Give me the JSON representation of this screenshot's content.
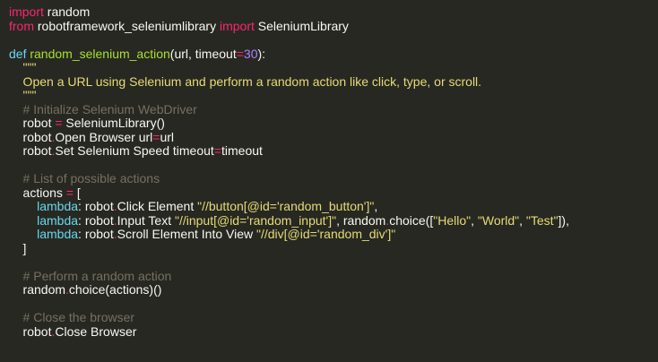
{
  "colors": {
    "background": "#272822",
    "plain": "#f8f8f2",
    "keyword": "#f92672",
    "function": "#a6e22e",
    "number": "#ae81ff",
    "string": "#e6db74",
    "comment": "#75715e",
    "builtin": "#66d9ef"
  },
  "code": {
    "lines": [
      [
        {
          "t": "kw",
          "v": "import"
        },
        {
          "t": "plain",
          "v": " random"
        }
      ],
      [
        {
          "t": "kw",
          "v": "from"
        },
        {
          "t": "plain",
          "v": " robotframework_seleniumlibrary "
        },
        {
          "t": "kw",
          "v": "import"
        },
        {
          "t": "plain",
          "v": " SeleniumLibrary"
        }
      ],
      [],
      [
        {
          "t": "builtin",
          "v": "def"
        },
        {
          "t": "plain",
          "v": " "
        },
        {
          "t": "fn",
          "v": "random_selenium_action"
        },
        {
          "t": "plain",
          "v": "(url, timeout"
        },
        {
          "t": "kw",
          "v": "="
        },
        {
          "t": "num",
          "v": "30"
        },
        {
          "t": "plain",
          "v": "):"
        }
      ],
      [
        {
          "t": "str",
          "v": "    \"\"\""
        }
      ],
      [
        {
          "t": "str",
          "v": "    Open a URL using Selenium and perform a random action like click, type, or scroll."
        }
      ],
      [
        {
          "t": "str",
          "v": "    \"\"\""
        }
      ],
      [
        {
          "t": "cmt",
          "v": "    # Initialize Selenium WebDriver"
        }
      ],
      [
        {
          "t": "plain",
          "v": "    robot "
        },
        {
          "t": "kw",
          "v": "="
        },
        {
          "t": "plain",
          "v": " SeleniumLibrary()"
        }
      ],
      [
        {
          "t": "plain",
          "v": "    robot"
        },
        {
          "t": "kw",
          "v": "."
        },
        {
          "t": "plain",
          "v": "Open Browser url"
        },
        {
          "t": "kw",
          "v": "="
        },
        {
          "t": "plain",
          "v": "url"
        }
      ],
      [
        {
          "t": "plain",
          "v": "    robot"
        },
        {
          "t": "kw",
          "v": "."
        },
        {
          "t": "plain",
          "v": "Set Selenium Speed timeout"
        },
        {
          "t": "kw",
          "v": "="
        },
        {
          "t": "plain",
          "v": "timeout"
        }
      ],
      [],
      [
        {
          "t": "cmt",
          "v": "    # List of possible actions"
        }
      ],
      [
        {
          "t": "plain",
          "v": "    actions "
        },
        {
          "t": "kw",
          "v": "="
        },
        {
          "t": "plain",
          "v": " ["
        }
      ],
      [
        {
          "t": "builtin",
          "v": "        lambda"
        },
        {
          "t": "plain",
          "v": ": robot"
        },
        {
          "t": "kw",
          "v": "."
        },
        {
          "t": "plain",
          "v": "Click Element "
        },
        {
          "t": "str",
          "v": "\"//button[@id='random_button']\""
        },
        {
          "t": "plain",
          "v": ","
        }
      ],
      [
        {
          "t": "builtin",
          "v": "        lambda"
        },
        {
          "t": "plain",
          "v": ": robot"
        },
        {
          "t": "kw",
          "v": "."
        },
        {
          "t": "plain",
          "v": "Input Text "
        },
        {
          "t": "str",
          "v": "\"//input[@id='random_input']\""
        },
        {
          "t": "plain",
          "v": ", random"
        },
        {
          "t": "kw",
          "v": "."
        },
        {
          "t": "plain",
          "v": "choice(["
        },
        {
          "t": "str",
          "v": "\"Hello\""
        },
        {
          "t": "plain",
          "v": ", "
        },
        {
          "t": "str",
          "v": "\"World\""
        },
        {
          "t": "plain",
          "v": ", "
        },
        {
          "t": "str",
          "v": "\"Test\""
        },
        {
          "t": "plain",
          "v": "]),"
        }
      ],
      [
        {
          "t": "builtin",
          "v": "        lambda"
        },
        {
          "t": "plain",
          "v": ": robot"
        },
        {
          "t": "kw",
          "v": "."
        },
        {
          "t": "plain",
          "v": "Scroll Element Into View "
        },
        {
          "t": "str",
          "v": "\"//div[@id='random_div']\""
        }
      ],
      [
        {
          "t": "plain",
          "v": "    ]"
        }
      ],
      [],
      [
        {
          "t": "cmt",
          "v": "    # Perform a random action"
        }
      ],
      [
        {
          "t": "plain",
          "v": "    random"
        },
        {
          "t": "kw",
          "v": "."
        },
        {
          "t": "plain",
          "v": "choice(actions)()"
        }
      ],
      [],
      [
        {
          "t": "cmt",
          "v": "    # Close the browser"
        }
      ],
      [
        {
          "t": "plain",
          "v": "    robot"
        },
        {
          "t": "kw",
          "v": "."
        },
        {
          "t": "plain",
          "v": "Close Browser"
        }
      ]
    ]
  }
}
